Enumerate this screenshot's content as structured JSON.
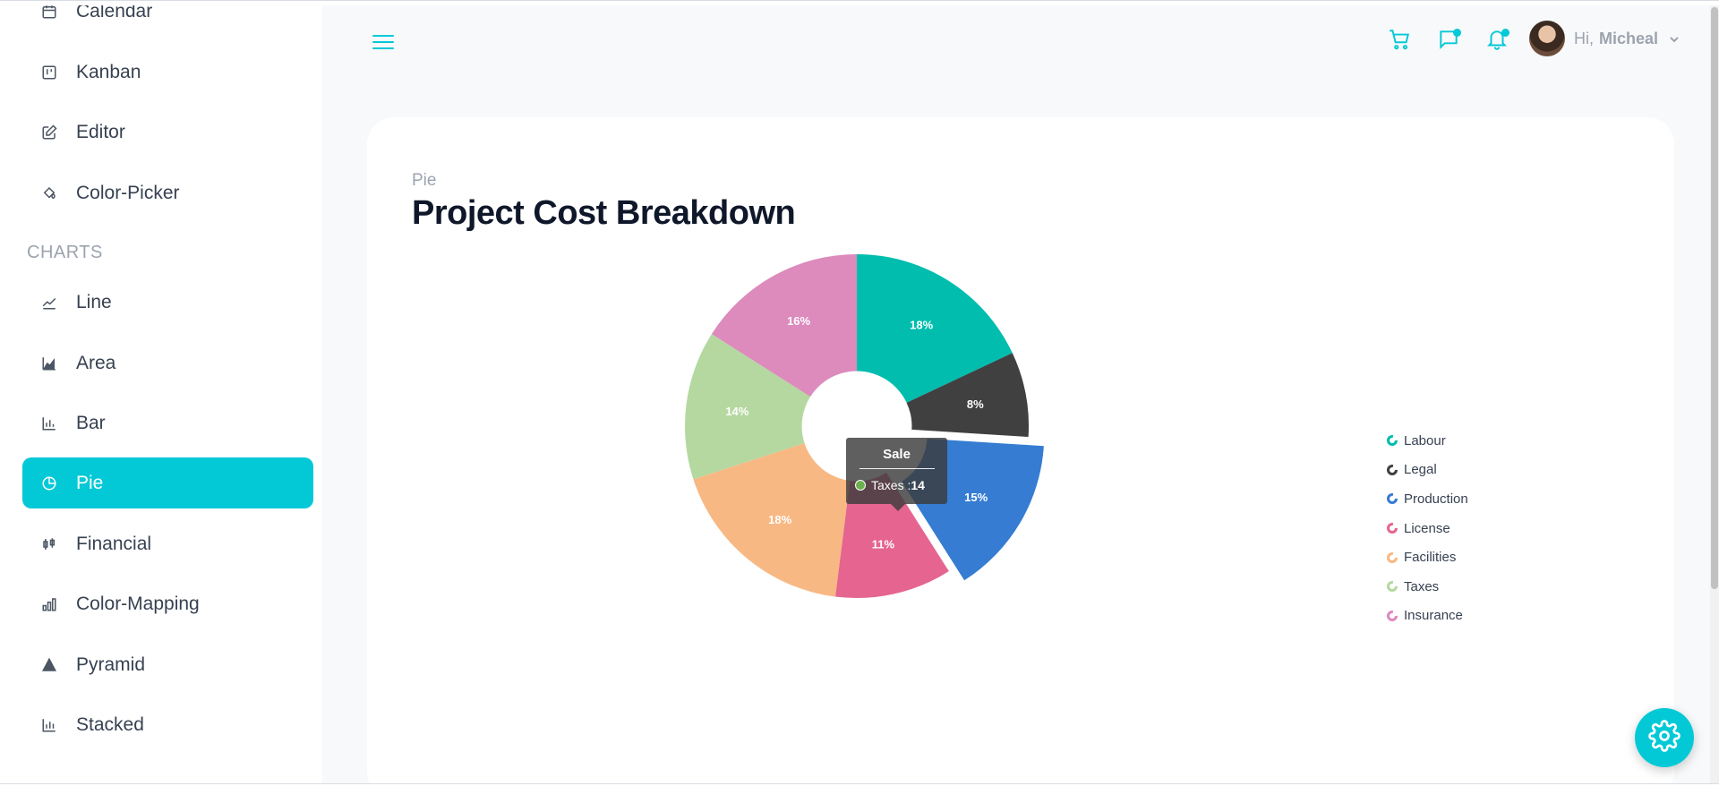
{
  "sidebar": {
    "items_top": [
      {
        "label": "Calendar",
        "icon": "calendar-icon"
      },
      {
        "label": "Kanban",
        "icon": "kanban-icon"
      },
      {
        "label": "Editor",
        "icon": "edit-icon"
      },
      {
        "label": "Color-Picker",
        "icon": "paint-bucket-icon"
      }
    ],
    "section_charts": "CHARTS",
    "items_charts": [
      {
        "label": "Line",
        "icon": "line-chart-icon"
      },
      {
        "label": "Area",
        "icon": "area-chart-icon"
      },
      {
        "label": "Bar",
        "icon": "bar-chart-icon"
      },
      {
        "label": "Pie",
        "icon": "pie-chart-icon",
        "active": true
      },
      {
        "label": "Financial",
        "icon": "financial-icon"
      },
      {
        "label": "Color-Mapping",
        "icon": "color-mapping-icon"
      },
      {
        "label": "Pyramid",
        "icon": "pyramid-icon"
      },
      {
        "label": "Stacked",
        "icon": "stacked-chart-icon"
      }
    ]
  },
  "header": {
    "greeting": "Hi,",
    "username": "Micheal"
  },
  "page": {
    "category": "Pie",
    "title": "Project Cost Breakdown"
  },
  "tooltip": {
    "title": "Sale",
    "label": "Taxes : ",
    "value": "14"
  },
  "colors": {
    "accent": "#03c9d7"
  },
  "chart_data": {
    "type": "pie",
    "inner_radius_ratio": 0.32,
    "legend_position": "right",
    "slices": [
      {
        "name": "Labour",
        "value": 18,
        "label": "18%",
        "color": "#00bdae"
      },
      {
        "name": "Legal",
        "value": 8,
        "label": "8%",
        "color": "#404041"
      },
      {
        "name": "Production",
        "value": 15,
        "label": "15%",
        "color": "#357cd2",
        "exploded": true
      },
      {
        "name": "License",
        "value": 11,
        "label": "11%",
        "color": "#e56590"
      },
      {
        "name": "Facilities",
        "value": 18,
        "label": "18%",
        "color": "#f8b883"
      },
      {
        "name": "Taxes",
        "value": 14,
        "label": "14%",
        "color": "#b5d8a0",
        "hovered": true
      },
      {
        "name": "Insurance",
        "value": 16,
        "label": "16%",
        "color": "#dd8abd"
      }
    ]
  }
}
